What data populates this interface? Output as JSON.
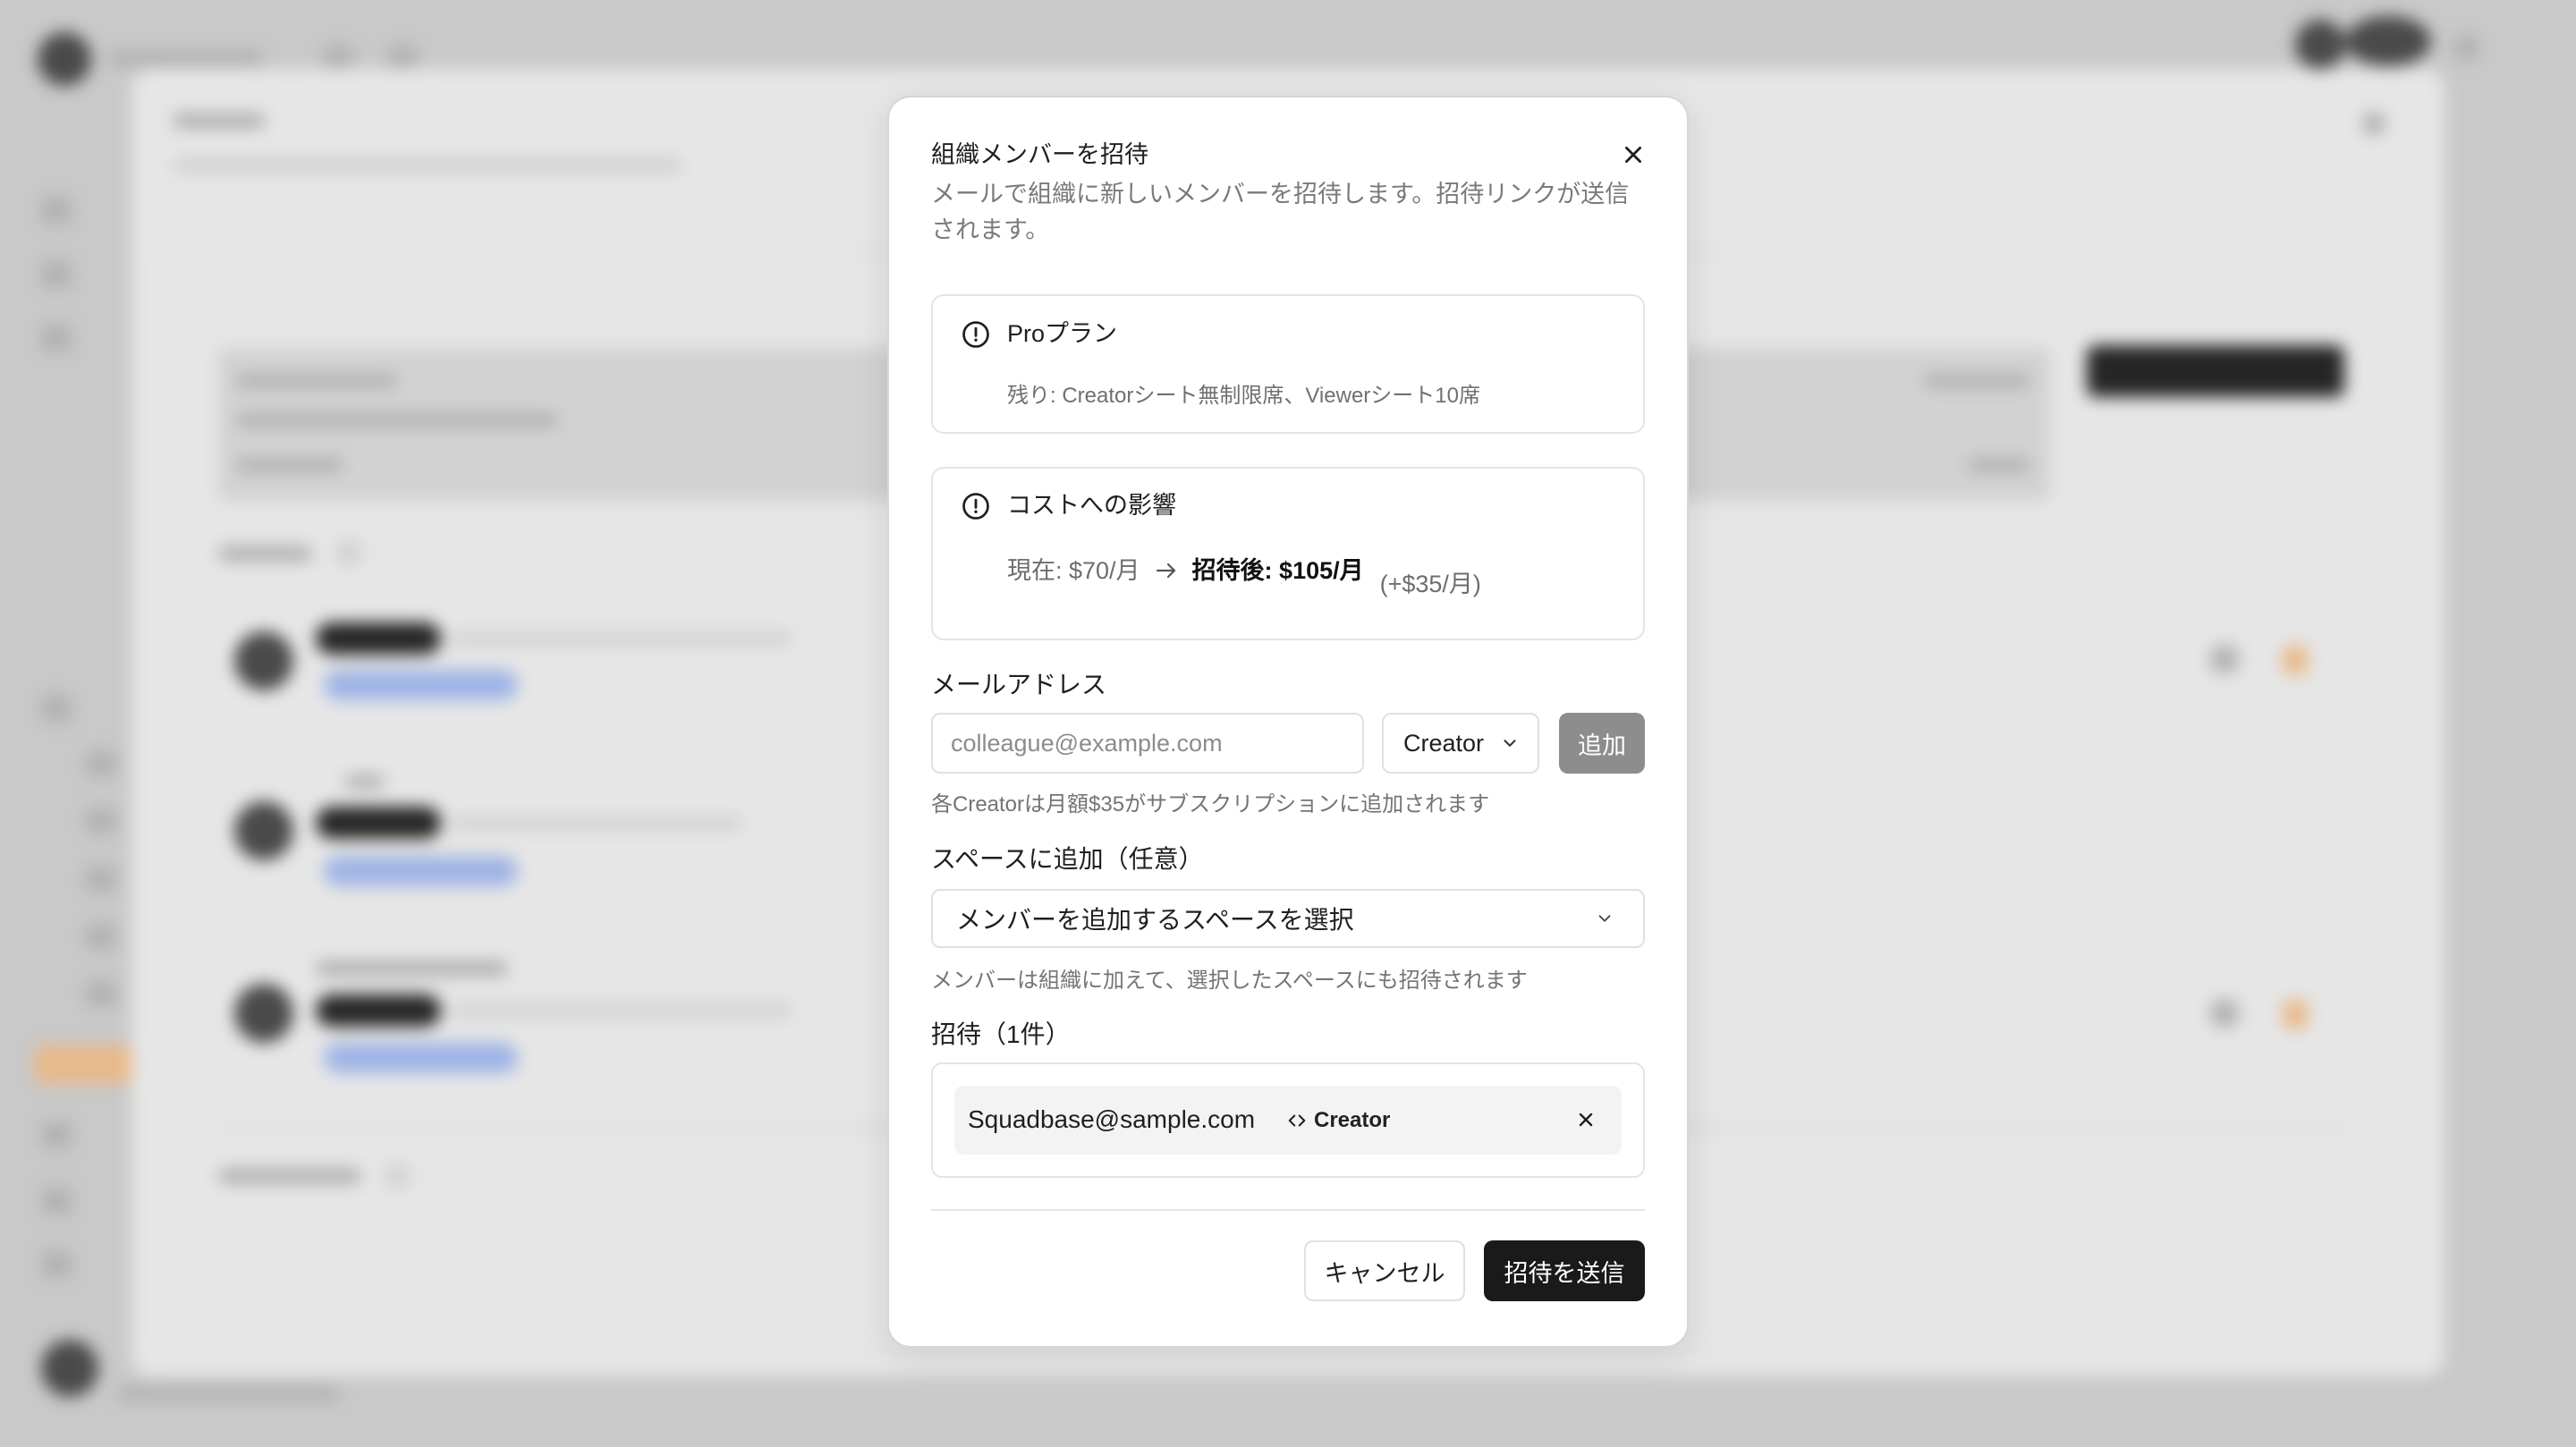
{
  "modal": {
    "title": "組織メンバーを招待",
    "description": "メールで組織に新しいメンバーを招待します。招待リンクが送信されます。",
    "close_icon": "close-icon",
    "plan_card": {
      "icon": "alert-circle-icon",
      "title": "Proプラン",
      "detail": "残り: Creatorシート無制限席、Viewerシート10席"
    },
    "cost_card": {
      "icon": "alert-circle-icon",
      "title": "コストへの影響",
      "current": "現在: $70/月",
      "arrow_icon": "arrow-right-icon",
      "after": "招待後: $105/月",
      "diff": "(+$35/月)"
    },
    "email": {
      "label": "メールアドレス",
      "placeholder": "colleague@example.com",
      "role_select": "Creator",
      "add_button": "追加",
      "helper": "各Creatorは月額$35がサブスクリプションに追加されます"
    },
    "space": {
      "label": "スペースに追加（任意）",
      "placeholder": "メンバーを追加するスペースを選択",
      "helper": "メンバーは組織に加えて、選択したスペースにも招待されます"
    },
    "invites": {
      "label": "招待（1件）",
      "items": [
        {
          "email": "Squadbase@sample.com",
          "role": "Creator",
          "role_icon": "code-icon"
        }
      ]
    },
    "footer": {
      "cancel": "キャンセル",
      "submit": "招待を送信"
    }
  },
  "colors": {
    "primary_button": "#1a1a1a",
    "disabled_button": "#8d8d8d",
    "border": "#e0e0e0",
    "muted_text": "#707070"
  }
}
